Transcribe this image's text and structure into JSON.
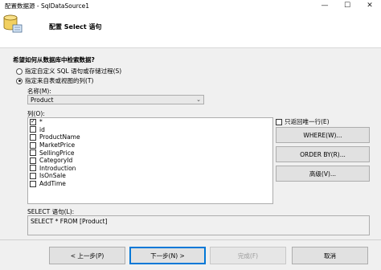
{
  "window": {
    "title": "配置数据源 - SqlDataSource1",
    "minimize_glyph": "—",
    "maximize_glyph": "☐",
    "close_glyph": "✕"
  },
  "header": {
    "title": "配置 Select 语句",
    "icon": "database-icon"
  },
  "question": "希望如何从数据库中检索数据?",
  "radios": [
    {
      "label": "指定自定义 SQL 语句或存储过程(S)",
      "selected": false
    },
    {
      "label": "指定来自表或视图的列(T)",
      "selected": true
    }
  ],
  "name_label": "名称(M):",
  "table_select": {
    "value": "Product",
    "arrow": "⌄"
  },
  "columns_label": "列(O):",
  "columns": [
    {
      "name": "*",
      "checked": true
    },
    {
      "name": "id",
      "checked": false
    },
    {
      "name": "ProductName",
      "checked": false
    },
    {
      "name": "MarketPrice",
      "checked": false
    },
    {
      "name": "SellingPrice",
      "checked": false
    },
    {
      "name": "CategoryId",
      "checked": false
    },
    {
      "name": "Introduction",
      "checked": false
    },
    {
      "name": "IsOnSale",
      "checked": false
    },
    {
      "name": "AddTime",
      "checked": false
    }
  ],
  "only_unique": {
    "label": "只返回唯一行(E)",
    "checked": false
  },
  "side_buttons": {
    "where": "WHERE(W)...",
    "orderby": "ORDER BY(R)...",
    "advanced": "高级(V)..."
  },
  "sql_label": "SELECT 语句(L):",
  "sql_text": "SELECT * FROM [Product]",
  "footer": {
    "prev": "< 上一步(P)",
    "next": "下一步(N) >",
    "finish": "完成(F)",
    "cancel": "取消"
  },
  "colors": {
    "accent": "#0078d7",
    "border": "#adadad",
    "panel": "#f0f0f0"
  }
}
